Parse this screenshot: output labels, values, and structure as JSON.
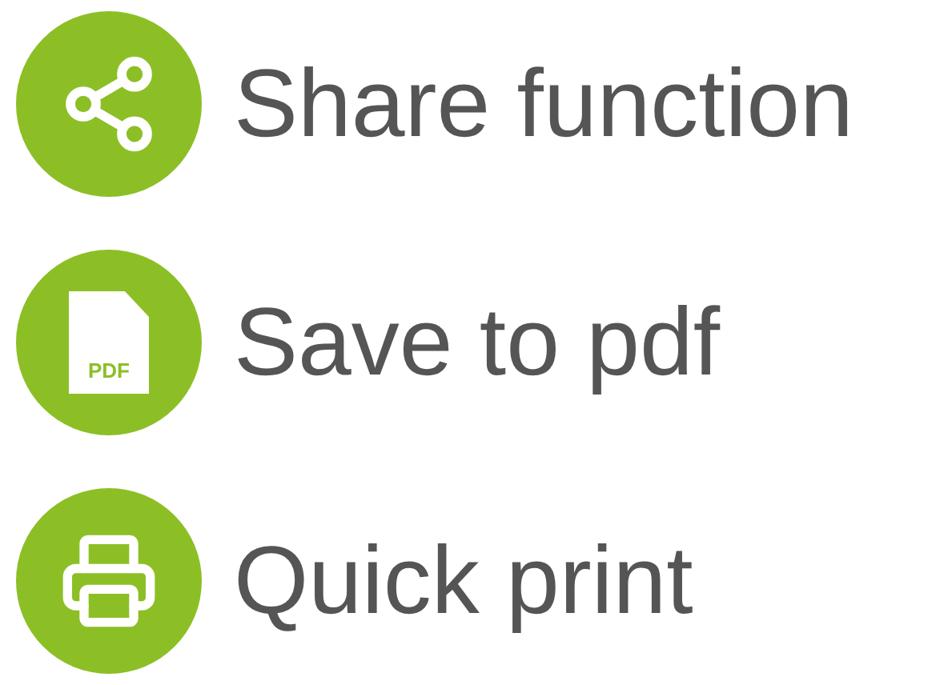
{
  "features": [
    {
      "kind": "share",
      "label": "Share function"
    },
    {
      "kind": "pdf",
      "label": "Save to pdf",
      "icon_text": "PDF"
    },
    {
      "kind": "print",
      "label": "Quick print"
    }
  ]
}
